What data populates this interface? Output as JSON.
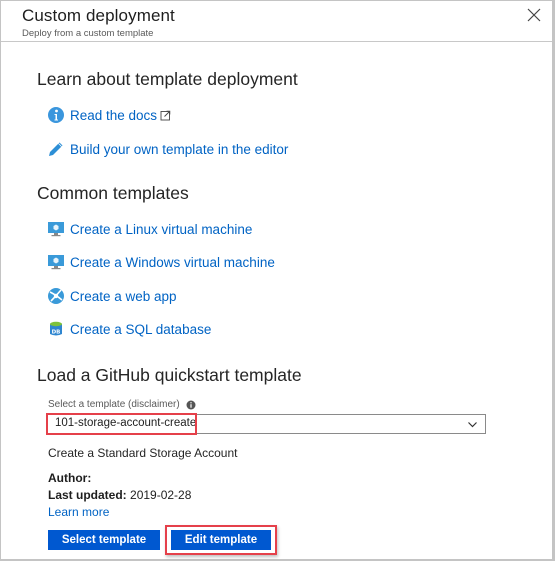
{
  "header": {
    "title": "Custom deployment",
    "subtitle": "Deploy from a custom template",
    "close_icon": "close-icon"
  },
  "learn": {
    "title": "Learn about template deployment",
    "links": [
      {
        "label": "Read the docs",
        "icon": "info-icon",
        "external": true
      },
      {
        "label": "Build your own template in the editor",
        "icon": "pencil-icon"
      }
    ]
  },
  "common": {
    "title": "Common templates",
    "links": [
      {
        "label": "Create a Linux virtual machine",
        "icon": "monitor-vm-icon"
      },
      {
        "label": "Create a Windows virtual machine",
        "icon": "monitor-vm-icon"
      },
      {
        "label": "Create a web app",
        "icon": "web-app-globe-icon"
      },
      {
        "label": "Create a SQL database",
        "icon": "sql-database-icon"
      }
    ]
  },
  "github": {
    "title": "Load a GitHub quickstart template",
    "select_label": "Select a template (disclaimer)",
    "selected_value": "101-storage-account-create",
    "description": "Create a Standard Storage Account",
    "author_label": "Author:",
    "author_value": "",
    "updated_label": "Last updated:",
    "updated_value": "2019-02-28",
    "learn_more": "Learn more",
    "select_button": "Select template",
    "edit_button": "Edit template"
  },
  "colors": {
    "link": "#0063c4",
    "button": "#0058d0",
    "highlight": "#e5404a"
  }
}
